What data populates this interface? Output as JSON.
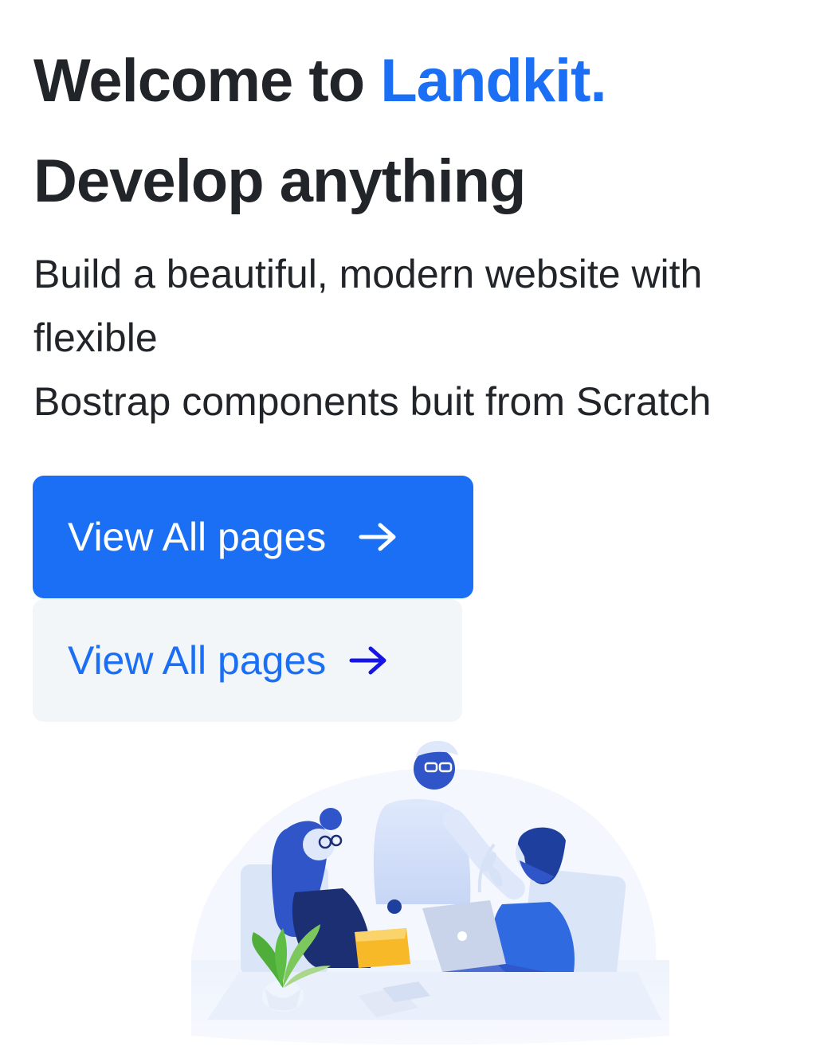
{
  "hero": {
    "headline_prefix": "Welcome to ",
    "headline_brand": "Landkit.",
    "headline_line2": "Develop anything",
    "lead_line1": "Build a beautiful, modern website with",
    "lead_line2": "flexible",
    "lead_line3": "Bostrap components buit from Scratch"
  },
  "buttons": {
    "primary_label": "View All pages",
    "secondary_label": "View All pages"
  },
  "icons": {
    "primary_arrow": "arrow-right-icon",
    "secondary_arrow": "arrow-right-icon"
  },
  "colors": {
    "accent": "#1a6ff5",
    "text": "#212529",
    "soft_bg": "#f3f6f9"
  }
}
